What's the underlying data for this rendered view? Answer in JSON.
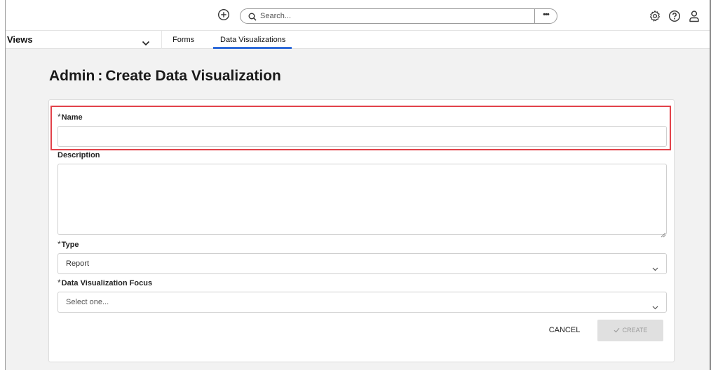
{
  "topbar": {
    "search": {
      "placeholder": "Search...",
      "more": "•••"
    },
    "icons": {
      "add": "plus-circle-icon",
      "settings": "gear-icon",
      "help": "help-circle-icon",
      "profile": "user-icon"
    }
  },
  "navbar": {
    "views_label": "Views",
    "tabs": [
      {
        "label": "Forms",
        "active": false
      },
      {
        "label": "Data Visualizations",
        "active": true
      }
    ],
    "active_color": "#2f6bd9"
  },
  "page": {
    "title_prefix": "Admin",
    "title_sep": ":",
    "title_main": "Create Data Visualization"
  },
  "form": {
    "required_mark": "*",
    "name": {
      "label": "Name",
      "value": ""
    },
    "description": {
      "label": "Description",
      "value": ""
    },
    "type": {
      "label": "Type",
      "value": "Report"
    },
    "focus": {
      "label": "Data Visualization Focus",
      "placeholder": "Select one..."
    },
    "highlight_color": "#e2424a",
    "buttons": {
      "cancel": "CANCEL",
      "create": "CREATE"
    }
  }
}
